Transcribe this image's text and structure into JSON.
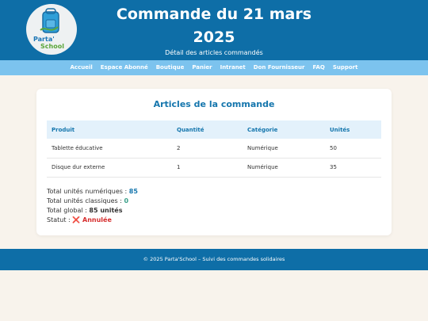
{
  "logo": {
    "line1": "Parta'",
    "line2": "School"
  },
  "header": {
    "title_line1": "Commande du 21 mars",
    "title_line2": "2025",
    "subtitle": "Détail des articles commandés"
  },
  "nav": [
    "Accueil",
    "Espace Abonné",
    "Boutique",
    "Panier",
    "Intranet",
    "Don Fournisseur",
    "FAQ",
    "Support"
  ],
  "card": {
    "title": "Articles de la commande",
    "columns": [
      "Produit",
      "Quantité",
      "Catégorie",
      "Unités"
    ],
    "rows": [
      [
        "Tablette éducative",
        "2",
        "Numérique",
        "50"
      ],
      [
        "Disque dur externe",
        "1",
        "Numérique",
        "35"
      ]
    ]
  },
  "totals": {
    "num_label": "Total unités numériques : ",
    "num_value": "85",
    "classic_label": "Total unités classiques : ",
    "classic_value": "0",
    "global_label": "Total global : ",
    "global_value": "85 unités",
    "status_label": "Statut : ",
    "status_value": "❌ Annulée"
  },
  "footer": "© 2025 Parta'School – Suivi des commandes solidaires",
  "colors": {
    "primary": "#0e6ea7",
    "nav": "#7cc3ee",
    "accent": "#1576ad",
    "danger": "#d62d2d",
    "success": "#3aa08a"
  }
}
